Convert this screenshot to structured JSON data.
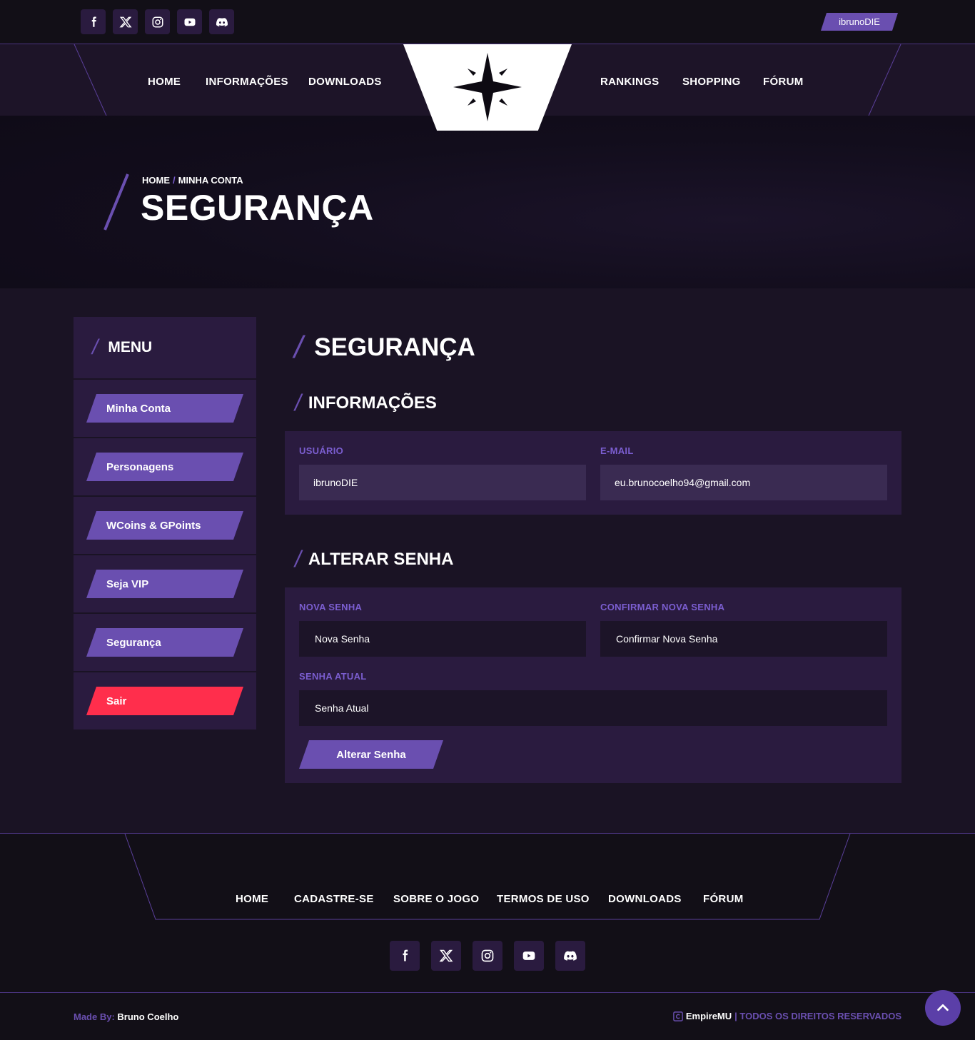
{
  "topbar": {
    "social_icons": [
      "facebook-icon",
      "x-icon",
      "instagram-icon",
      "youtube-icon",
      "discord-icon"
    ],
    "username": "ibrunoDIE"
  },
  "nav": {
    "left": [
      "HOME",
      "INFORMAÇÕES",
      "DOWNLOADS"
    ],
    "right": [
      "RANKINGS",
      "SHOPPING",
      "FÓRUM"
    ],
    "logo_icon": "compass-star-icon"
  },
  "hero": {
    "breadcrumb_home": "HOME",
    "breadcrumb_sep": "/",
    "breadcrumb_current": "MINHA CONTA",
    "title": "SEGURANÇA"
  },
  "sidebar": {
    "title": "MENU",
    "slash": "/",
    "items": [
      "Minha Conta",
      "Personagens",
      "WCoins & GPoints",
      "Seja VIP",
      "Segurança",
      "Sair"
    ]
  },
  "content": {
    "title": "SEGURANÇA",
    "info_section": {
      "title": "INFORMAÇÕES",
      "user_label": "USUÁRIO",
      "user_value": "ibrunoDIE",
      "email_label": "E-MAIL",
      "email_value": "eu.brunocoelho94@gmail.com"
    },
    "password_section": {
      "title": "ALTERAR SENHA",
      "new_label": "NOVA SENHA",
      "new_placeholder": "Nova Senha",
      "confirm_label": "CONFIRMAR NOVA SENHA",
      "confirm_placeholder": "Confirmar Nova Senha",
      "current_label": "SENHA ATUAL",
      "current_placeholder": "Senha Atual",
      "submit": "Alterar Senha"
    }
  },
  "footer": {
    "nav": [
      "HOME",
      "CADASTRE-SE",
      "SOBRE O JOGO",
      "TERMOS DE USO",
      "DOWNLOADS",
      "FÓRUM"
    ],
    "made_by_label": "Made By:",
    "made_by_name": "Bruno Coelho",
    "brand": "EmpireMU",
    "rights": "| TODOS OS DIREITOS RESERVADOS",
    "copyright_icon": "copyright-icon",
    "back_to_top_icon": "chevron-up-icon"
  },
  "colors": {
    "accent": "#6a4fb0",
    "danger": "#ff2e4c",
    "background": "#120f17",
    "panel": "#2a1b3f"
  }
}
